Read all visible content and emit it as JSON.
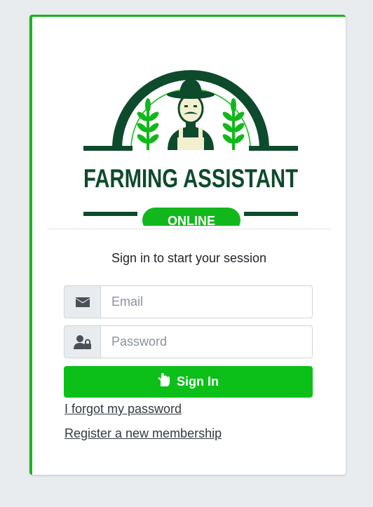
{
  "logo": {
    "title": "FARMING ASSISTANT",
    "badge": "ONLINE",
    "dark_green": "#0e4a2c",
    "bright_green": "#12b81b"
  },
  "login": {
    "subtitle": "Sign in to start your session",
    "email_placeholder": "Email",
    "password_placeholder": "Password",
    "email_icon": "envelope-icon",
    "password_icon": "user-lock-icon",
    "signin_label": "Sign In",
    "signin_icon": "hand-icon",
    "forgot_link": "I forgot my password",
    "register_link": "Register a new membership"
  },
  "colors": {
    "accent": "#17b51a",
    "button": "#0cc019",
    "background": "#e9ecef"
  }
}
